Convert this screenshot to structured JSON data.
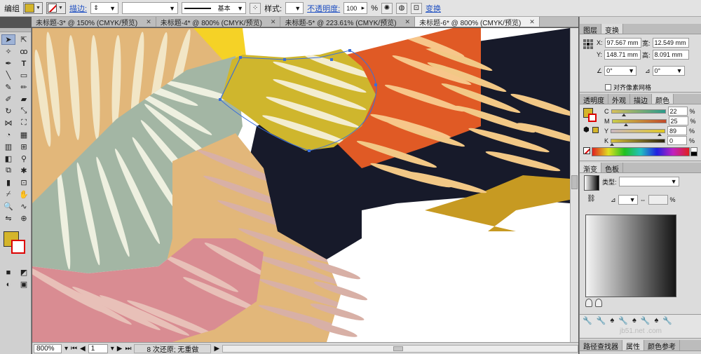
{
  "control_bar": {
    "selection_label": "编组",
    "stroke_label": "描边:",
    "brush_label": "基本",
    "style_label": "样式:",
    "opacity_label": "不透明度:",
    "opacity_value": "100",
    "opacity_unit": "%",
    "transform_label": "变换",
    "fill_color": "#d4b52a"
  },
  "tabs": [
    {
      "label": "未标题-3* @ 150% (CMYK/预览)",
      "active": false
    },
    {
      "label": "未标题-4* @ 800% (CMYK/预览)",
      "active": false
    },
    {
      "label": "未标题-5* @ 223.61% (CMYK/预览)",
      "active": false
    },
    {
      "label": "未标题-6* @ 800% (CMYK/预览)",
      "active": true
    }
  ],
  "status_bar": {
    "zoom": "800%",
    "artboard": "1",
    "history": "8 次还原; 无重做"
  },
  "transform_panel": {
    "tabs": [
      "图层",
      "变换"
    ],
    "x_label": "X:",
    "x_value": "97.567 mm",
    "y_label": "Y:",
    "y_value": "148.71 mm",
    "w_label": "宽:",
    "w_value": "12.549 mm",
    "h_label": "高:",
    "h_value": "8.091 mm",
    "angle_value": "0°",
    "shear_value": "0°",
    "align_pixel_label": "对齐像素网格"
  },
  "color_panel": {
    "tabs": [
      "透明度",
      "外观",
      "描边",
      "颜色"
    ],
    "channels": [
      {
        "label": "C",
        "value": "22",
        "fraction": 0.22
      },
      {
        "label": "M",
        "value": "25",
        "fraction": 0.25
      },
      {
        "label": "Y",
        "value": "89",
        "fraction": 0.89
      },
      {
        "label": "K",
        "value": "0",
        "fraction": 0.0
      }
    ],
    "unit": "%",
    "fill_color": "#d4b52a"
  },
  "gradient_panel": {
    "tabs": [
      "渐变",
      "色板"
    ],
    "type_label": "类型:",
    "type_value": "",
    "percent_unit": "%"
  },
  "bottom_panel_tabs": [
    "路径查找器",
    "属性",
    "颜色参考"
  ],
  "watermark": "jb51.net .com"
}
